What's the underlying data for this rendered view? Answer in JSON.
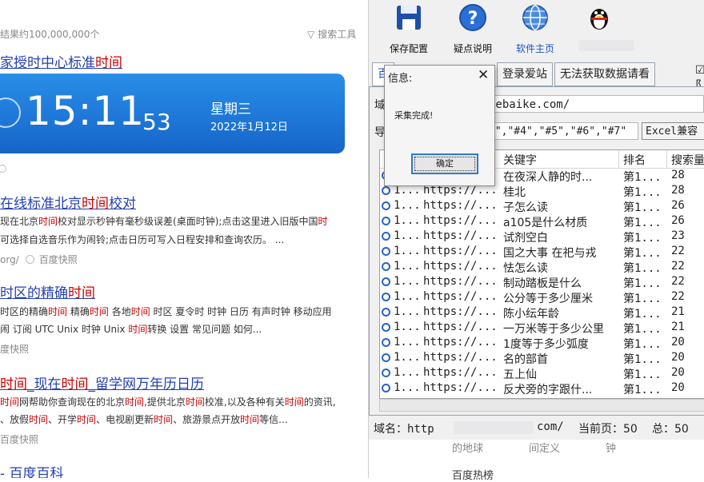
{
  "results": {
    "count": "结果约100,000,000个",
    "search_tools": "搜索工具",
    "r1_title": [
      "家授时中心标准",
      "时间"
    ],
    "timecard": {
      "hm": "15:11",
      "sec": "53",
      "weekday": "星期三",
      "date": "2022年1月12日"
    },
    "r2_title": [
      " 在线标准北京",
      "时间",
      "校对"
    ],
    "r2_line1": [
      "现在北京",
      "时间",
      "校对显示秒钟有毫秒级误差(桌面时钟);点击这里进入旧版中国",
      "时"
    ],
    "r2_line2": "可选择自选音乐作为闹铃;点击日历可写入日程安排和查询农历。 ...",
    "r2_meta_url": "org/",
    "snapshot": "百度快照",
    "r3_title": [
      "时区的精确",
      "时间"
    ],
    "r3_line1": [
      "时区的精确",
      "时间",
      " 精确",
      "时间",
      " 各地",
      "时间",
      " 时区 夏令时 时钟 日历 有声时钟 移动应用"
    ],
    "r3_line2": [
      "闹 订阅 UTC Unix 时钟 Unix ",
      "时间",
      "转换 设置 常见问题 如何..."
    ],
    "r3_meta": "度快照",
    "r4_title": [
      "时间",
      "_现在",
      "时间",
      "_留学网万年历日历"
    ],
    "r4_line1": [
      "时间",
      "网帮助你查询现在的北京",
      "时间",
      ",提供北京",
      "时间",
      "校准,以及各种有关",
      "时间",
      "的资讯,"
    ],
    "r4_line2": [
      "、放假",
      "时间",
      "、开学",
      "时间",
      "、电视剧更新",
      "时间",
      "、旅游景点开放",
      "时间",
      "等信..."
    ],
    "r4_meta": "百度快照",
    "r5_title": "- 百度百科"
  },
  "app": {
    "toolbar": [
      {
        "label": "保存配置",
        "icon": "floppy-disk-icon"
      },
      {
        "label": "疑点说明",
        "icon": "help-icon"
      },
      {
        "label": "软件主页",
        "icon": "globe-icon"
      },
      {
        "label": "",
        "icon": "qq-penguin-icon"
      }
    ],
    "tabs": [
      "百",
      "登录爱站",
      "无法获取数据请看"
    ],
    "checkbox_label": "☑ 阝",
    "domain_label": "域",
    "domain_value": "yebaike.com/",
    "keyword_label": "导",
    "keyword_value": "3\",\"#4\",\"#5\",\"#6\",\"#7\"",
    "excel_button": "Excel兼容",
    "columns": [
      "关键字",
      "排名",
      "搜索量"
    ],
    "rows": [
      {
        "c1": "1...",
        "c2": "https://...",
        "kw": "在夜深人静的时...",
        "rank": "第1...",
        "vol": "28"
      },
      {
        "c1": "1...",
        "c2": "https://...",
        "kw": "桂北",
        "rank": "第1...",
        "vol": "28"
      },
      {
        "c1": "1...",
        "c2": "https://...",
        "kw": "子怎么读",
        "rank": "第1...",
        "vol": "26"
      },
      {
        "c1": "1...",
        "c2": "https://...",
        "kw": "a105是什么材质",
        "rank": "第1...",
        "vol": "26"
      },
      {
        "c1": "1...",
        "c2": "https://...",
        "kw": "试剂空白",
        "rank": "第1...",
        "vol": "23"
      },
      {
        "c1": "1...",
        "c2": "https://...",
        "kw": "国之大事 在祀与戎",
        "rank": "第1...",
        "vol": "22"
      },
      {
        "c1": "1...",
        "c2": "https://...",
        "kw": "怯怎么读",
        "rank": "第1...",
        "vol": "22"
      },
      {
        "c1": "1...",
        "c2": "https://...",
        "kw": "制动踏板是什么",
        "rank": "第1...",
        "vol": "22"
      },
      {
        "c1": "1...",
        "c2": "https://...",
        "kw": "公分等于多少厘米",
        "rank": "第1...",
        "vol": "22"
      },
      {
        "c1": "1...",
        "c2": "https://...",
        "kw": "陈小纭年龄",
        "rank": "第1...",
        "vol": "21"
      },
      {
        "c1": "1...",
        "c2": "https://...",
        "kw": "一万米等于多少公里",
        "rank": "第1...",
        "vol": "21"
      },
      {
        "c1": "1...",
        "c2": "https://...",
        "kw": "1度等于多少弧度",
        "rank": "第1...",
        "vol": "20"
      },
      {
        "c1": "1...",
        "c2": "https://...",
        "kw": "名的部首",
        "rank": "第1...",
        "vol": "20"
      },
      {
        "c1": "1...",
        "c2": "https://...",
        "kw": "五上仙",
        "rank": "第1...",
        "vol": "20"
      },
      {
        "c1": "1...",
        "c2": "https://...",
        "kw": "反犬旁的字跟什...",
        "rank": "第1...",
        "vol": "20"
      }
    ],
    "status": {
      "domain_prefix": "域名：http",
      "domain_suffix": "com/",
      "current_page": "当前页：50",
      "total": "总：50"
    },
    "below": [
      "的地球",
      "间定义",
      "钟",
      "百度热榜"
    ]
  },
  "dialog": {
    "title": "信息:",
    "message": "采集完成!",
    "ok": "确定"
  },
  "colors": {
    "link": "#2440b3",
    "highlight": "#c00000",
    "card": "#1565c9",
    "accent": "#2e78d6"
  }
}
